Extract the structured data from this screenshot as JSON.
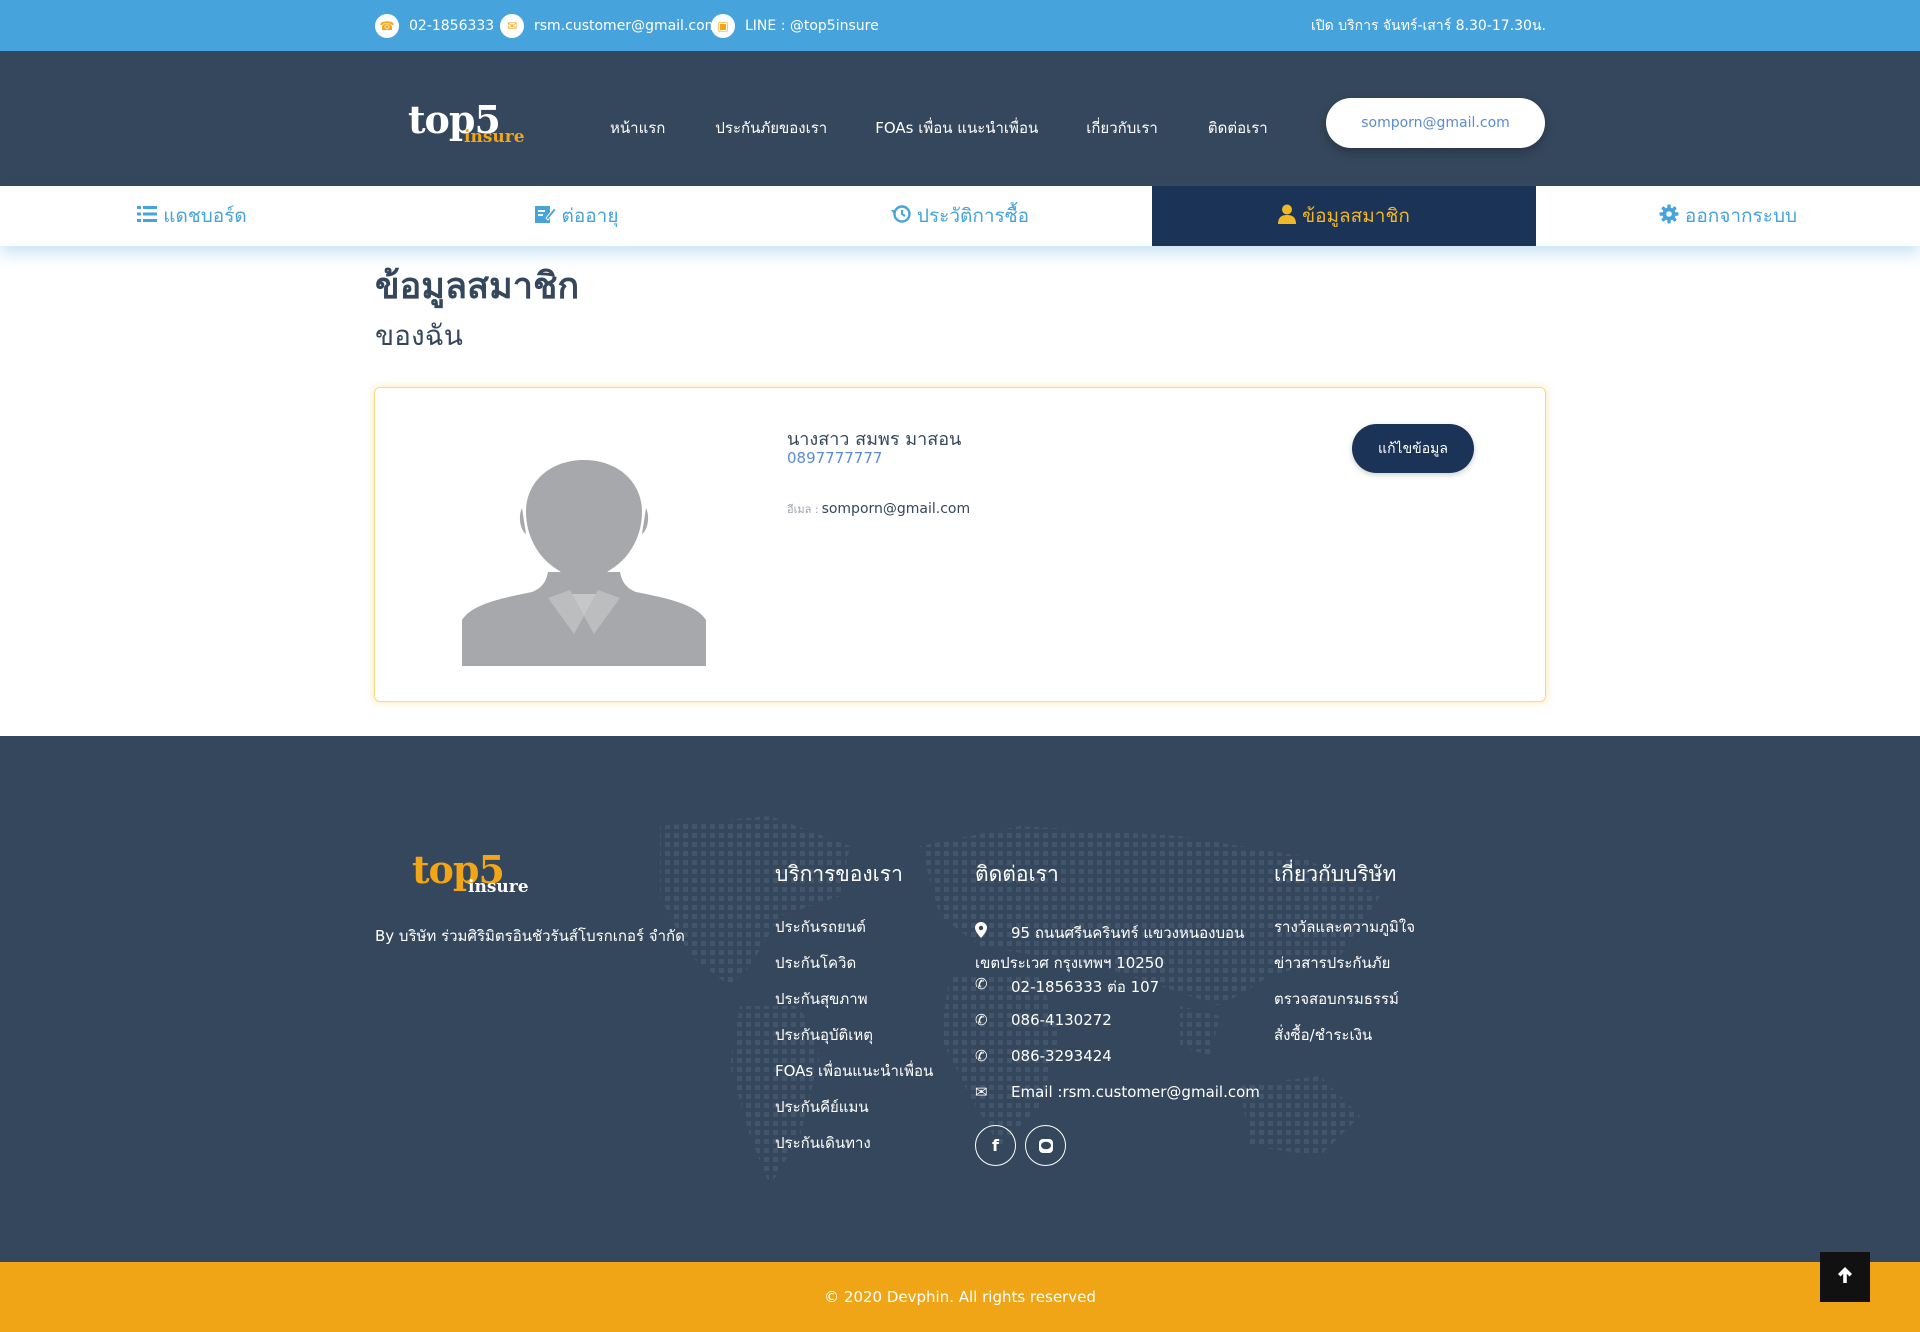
{
  "topbar": {
    "phone": "02-1856333",
    "email": "rsm.customer@gmail.com",
    "line": "LINE : @top5insure",
    "hours": "เปิด บริการ จันทร์-เสาร์ 8.30-17.30น.",
    "icons": [
      "phone-icon",
      "mail-icon",
      "line-icon"
    ]
  },
  "header": {
    "logo_main": "top5",
    "logo_sub": "insure",
    "nav": [
      "หน้าแรก",
      "ประกันภัยของเรา",
      "FOAs เพื่อน แนะนำเพื่อน",
      "เกี่ยวกับเรา",
      "ติดต่อเรา"
    ],
    "user_email": "somporn@gmail.com"
  },
  "tabs": [
    {
      "label": "แดชบอร์ด",
      "icon": "list-icon"
    },
    {
      "label": "ต่ออายุ",
      "icon": "edit-icon"
    },
    {
      "label": "ประวัติการซื้อ",
      "icon": "history-icon"
    },
    {
      "label": "ข้อมูลสมาชิก",
      "icon": "user-icon",
      "active": true
    },
    {
      "label": "ออกจากระบบ",
      "icon": "gear-icon"
    }
  ],
  "page": {
    "title": "ข้อมูลสมาชิก",
    "subtitle": "ของฉัน"
  },
  "member": {
    "name": "นางสาว สมพร มาสอน",
    "phone": "0897777777",
    "email_label": "อีเมล :",
    "email": "somporn@gmail.com",
    "edit_label": "แก้ไขข้อมูล"
  },
  "footer": {
    "logo_main": "top5",
    "logo_sub": "insure",
    "company": "By บริษัท ร่วมศิริมิตรอินชัวรันส์โบรกเกอร์ จำกัด",
    "services_title": "บริการของเรา",
    "services": [
      "ประกันรถยนต์",
      "ประกันโควิด",
      "ประกันสุขภาพ",
      "ประกันอุบัติเหตุ",
      "FOAs เพื่อนแนะนำเพื่อน",
      "ประกันคีย์แมน",
      "ประกันเดินทาง"
    ],
    "contact_title": "ติดต่อเรา",
    "address_line1": "95 ถนนศรีนครินทร์ แขวงหนองบอน",
    "address_line2": "เขตประเวศ กรุงเทพฯ 10250",
    "phones": [
      "02-1856333 ต่อ 107",
      "086-4130272",
      "086-3293424"
    ],
    "contact_email": "Email :rsm.customer@gmail.com",
    "about_title": "เกี่ยวกับบริษัท",
    "about": [
      "รางวัลและความภูมิใจ",
      "ข่าวสารประกันภัย",
      "ตรวจสอบกรมธรรม์",
      "สั่งซื้อ/ชำระเงิน"
    ],
    "social": [
      "facebook-icon",
      "line-icon"
    ]
  },
  "bottom": {
    "copyright": "© 2020 Devphin. All rights reserved"
  },
  "colors": {
    "topbar": "#46a3dc",
    "header": "#35475c",
    "accent": "#f2a516",
    "active_tab": "#1b3357",
    "tab_text": "#46a3dc"
  }
}
